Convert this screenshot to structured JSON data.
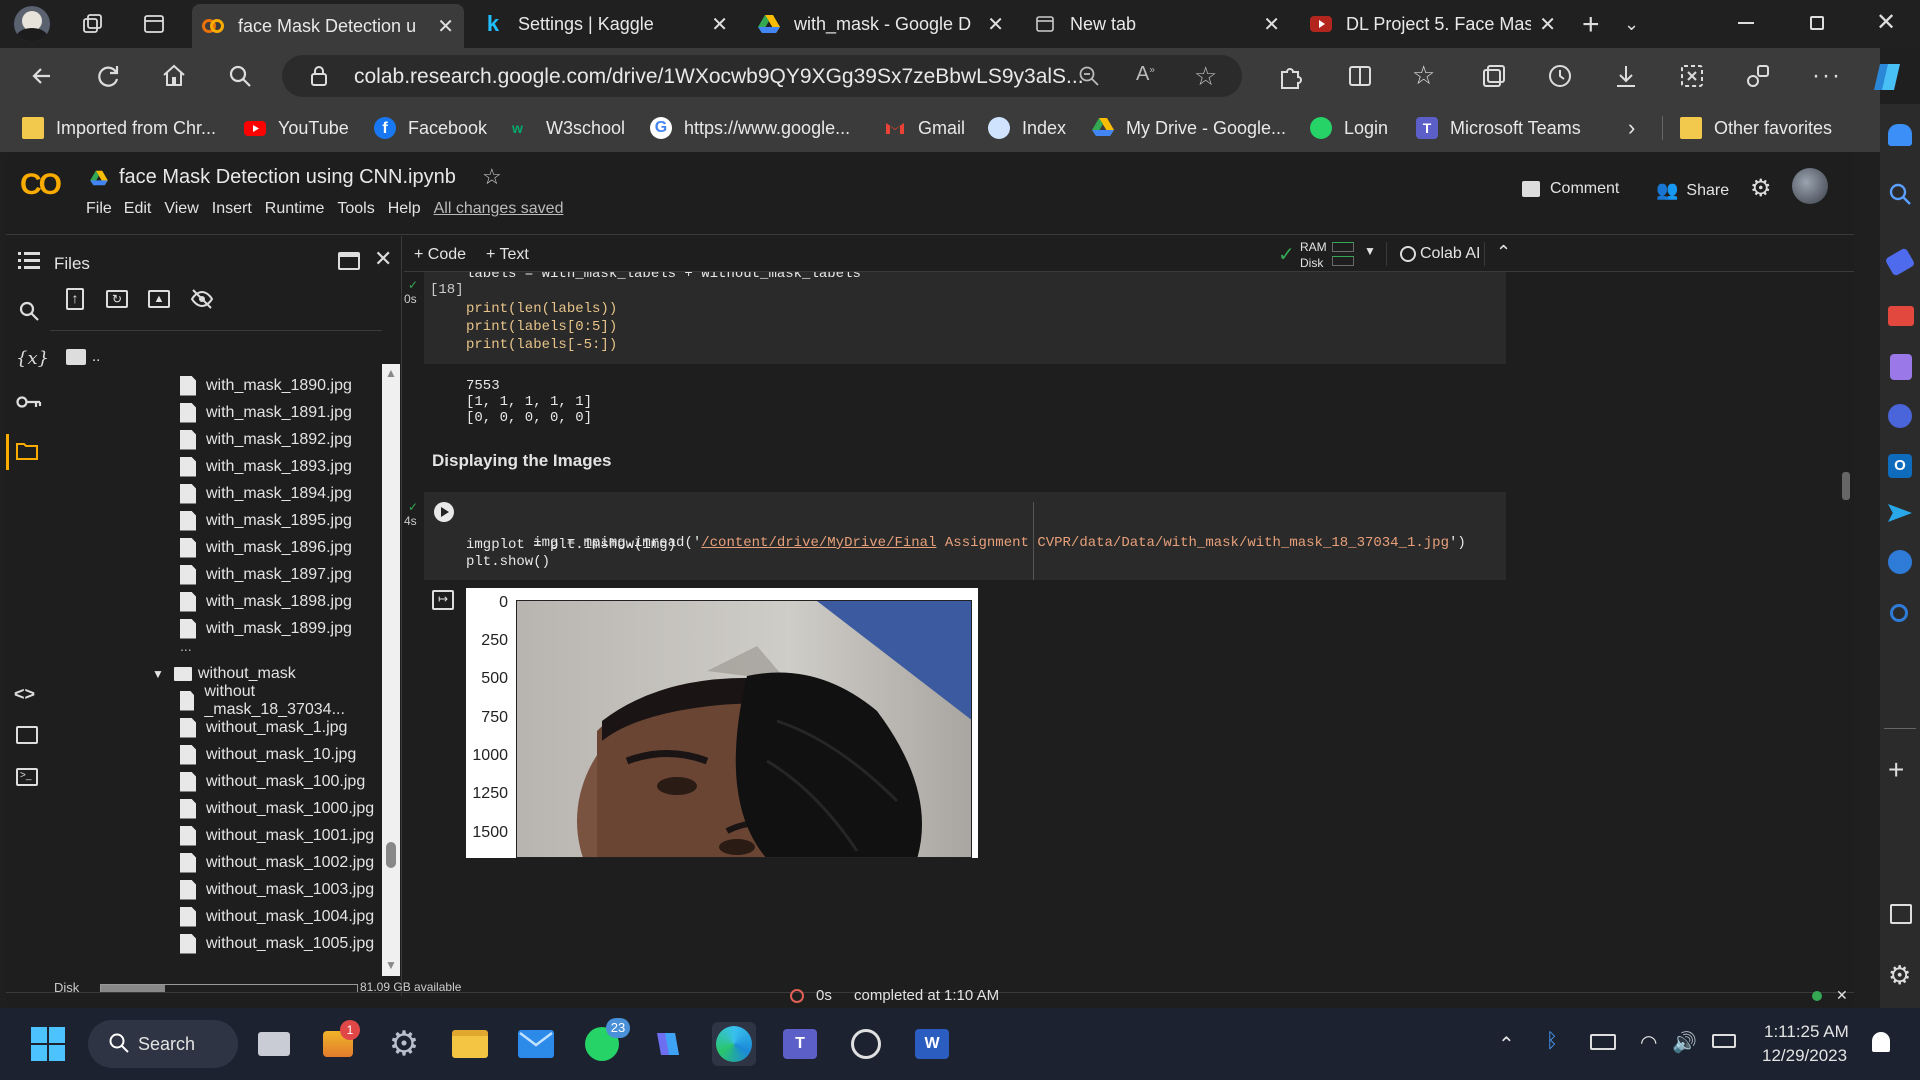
{
  "tabs": [
    {
      "title": "face Mask Detection u",
      "favicon": "colab-icon",
      "active": true
    },
    {
      "title": "Settings | Kaggle",
      "favicon": "kaggle-icon"
    },
    {
      "title": "with_mask - Google D",
      "favicon": "drive-icon"
    },
    {
      "title": "New tab",
      "favicon": "newtab-icon"
    },
    {
      "title": "DL Project 5. Face Mas",
      "favicon": "youtube-icon"
    }
  ],
  "address": {
    "url": "colab.research.google.com/drive/1WXocwb9QY9XGg39Sx7zeBbwLS9y3alS..."
  },
  "bookmarks": [
    {
      "label": "Imported from Chr...",
      "icon": "folder-icon"
    },
    {
      "label": "YouTube",
      "icon": "youtube-icon"
    },
    {
      "label": "Facebook",
      "icon": "facebook-icon"
    },
    {
      "label": "W3school",
      "icon": "w3-icon"
    },
    {
      "label": "https://www.google...",
      "icon": "google-icon"
    },
    {
      "label": "Gmail",
      "icon": "gmail-icon"
    },
    {
      "label": "Index",
      "icon": "index-icon"
    },
    {
      "label": "My Drive - Google...",
      "icon": "drive-icon"
    },
    {
      "label": "Login",
      "icon": "whatsapp-icon"
    },
    {
      "label": "Microsoft Teams",
      "icon": "teams-icon"
    }
  ],
  "bookmarks_other": "Other favorites",
  "colab": {
    "notebook_title": "face Mask Detection using CNN.ipynb",
    "menu": [
      "File",
      "Edit",
      "View",
      "Insert",
      "Runtime",
      "Tools",
      "Help"
    ],
    "saved_status": "All changes saved",
    "comment_label": "Comment",
    "share_label": "Share",
    "add_code": "+ Code",
    "add_text": "+ Text",
    "ram_label": "RAM",
    "disk_label": "Disk",
    "colab_ai": "Colab AI"
  },
  "files_panel": {
    "title": "Files",
    "parent": "..",
    "with_mask_files": [
      "with_mask_1890.jpg",
      "with_mask_1891.jpg",
      "with_mask_1892.jpg",
      "with_mask_1893.jpg",
      "with_mask_1894.jpg",
      "with_mask_1895.jpg",
      "with_mask_1896.jpg",
      "with_mask_1897.jpg",
      "with_mask_1898.jpg",
      "with_mask_1899.jpg"
    ],
    "ellipsis": "...",
    "folder": "without_mask",
    "without_mask_files": [
      "without _mask_18_37034...",
      "without_mask_1.jpg",
      "without_mask_10.jpg",
      "without_mask_100.jpg",
      "without_mask_1000.jpg",
      "without_mask_1001.jpg",
      "without_mask_1002.jpg",
      "without_mask_1003.jpg",
      "without_mask_1004.jpg",
      "without_mask_1005.jpg"
    ],
    "disk_label": "Disk",
    "disk_available": "81.09 GB available",
    "disk_used_fraction": 0.25
  },
  "cell1": {
    "exec_count": "[18]",
    "time": "0s",
    "code_first": "labels = with_mask_labels + without_mask_labels",
    "code_lines": [
      "print(len(labels))",
      "print(labels[0:5])",
      "print(labels[-5:])"
    ],
    "output": [
      "7553",
      "[1, 1, 1, 1, 1]",
      "[0, 0, 0, 0, 0]"
    ]
  },
  "text_cell": "Displaying the Images",
  "cell2": {
    "time": "4s",
    "line1_prefix": "img = mpimg.imread('",
    "line1_path": "/content/drive/MyDrive/Final",
    "line1_rest": " Assignment CVPR/data/Data/with_mask/with_mask_18_37034_1.jpg",
    "line1_end": "')",
    "line2": "imgplot = plt.imshow(img)",
    "line3": "plt.show()"
  },
  "plot": {
    "y_ticks": [
      "0",
      "250",
      "500",
      "750",
      "1000",
      "1250",
      "1500"
    ]
  },
  "status": {
    "time": "0s",
    "message": "completed at 1:10 AM"
  },
  "taskbar": {
    "search": "Search",
    "time": "1:11:25 AM",
    "date": "12/29/2023",
    "whatsapp_badge": "23",
    "notify_badge": "1"
  }
}
